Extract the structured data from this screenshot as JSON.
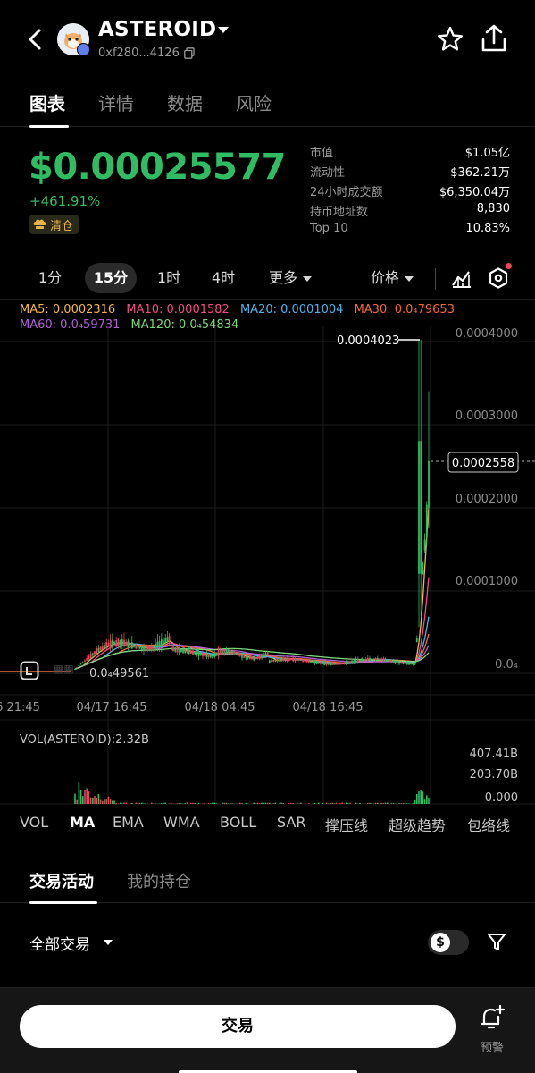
{
  "header": {
    "token_name": "ASTEROID",
    "address": "0xf280...4126",
    "back_icon": "chevron-left-icon",
    "star_icon": "star-icon",
    "share_icon": "share-icon"
  },
  "tabs": [
    {
      "label": "图表",
      "active": true
    },
    {
      "label": "详情"
    },
    {
      "label": "数据"
    },
    {
      "label": "风险"
    }
  ],
  "price": {
    "value": "$0.00025577",
    "change": "+461.91%",
    "badge": "清仓",
    "up_color": "#2fbc63"
  },
  "stats": [
    {
      "label": "市值",
      "value": "$1.05亿"
    },
    {
      "label": "流动性",
      "value": "$362.21万"
    },
    {
      "label": "24小时成交额",
      "value": "$6,350.04万"
    },
    {
      "label": "持币地址数",
      "value": "8,830"
    },
    {
      "label": "Top 10",
      "value": "10.83%"
    }
  ],
  "toolbar": {
    "timeframes": [
      "1分",
      "15分",
      "1时",
      "4时"
    ],
    "active_timeframe": "15分",
    "more_label": "更多",
    "price_label": "价格"
  },
  "ma_legend": {
    "ma5": "MA5: 0.0002316",
    "ma10": "MA10: 0.0001582",
    "ma20": "MA20: 0.0001004",
    "ma30": "MA30: 0.0₄79653",
    "ma60": "MA60: 0.0₄59731",
    "ma120": "MA120: 0.0₄54834",
    "colors": {
      "ma5": "#f3b94a",
      "ma10": "#f04e8a",
      "ma20": "#4fb3e8",
      "ma30": "#f06a3c",
      "ma60": "#b35fd8",
      "ma120": "#7ed87a"
    }
  },
  "chart": {
    "y_ticks": [
      "0.0004000",
      "0.0003000",
      "0.0002000",
      "0.0001000",
      "0.0₄"
    ],
    "x_ticks": [
      "6 21:45",
      "04/17 16:45",
      "04/18 04:45",
      "04/18 16:45"
    ],
    "high_label": "0.0004023",
    "low_label": "0.0₄49561",
    "current_label": "0.0002558",
    "vol_label": "VOL(ASTEROID):2.32B",
    "vol_ticks": [
      "407.41B",
      "203.70B",
      "0.000"
    ]
  },
  "indicators": [
    "VOL",
    "MA",
    "EMA",
    "WMA",
    "BOLL",
    "SAR",
    "撑压线",
    "超级趋势",
    "包络线"
  ],
  "active_indicator": "MA",
  "activity": {
    "tabs": [
      "交易活动",
      "我的持仓"
    ],
    "filter_label": "全部交易",
    "currency_symbol": "$"
  },
  "bottom": {
    "trade_label": "交易",
    "alert_label": "预警"
  }
}
